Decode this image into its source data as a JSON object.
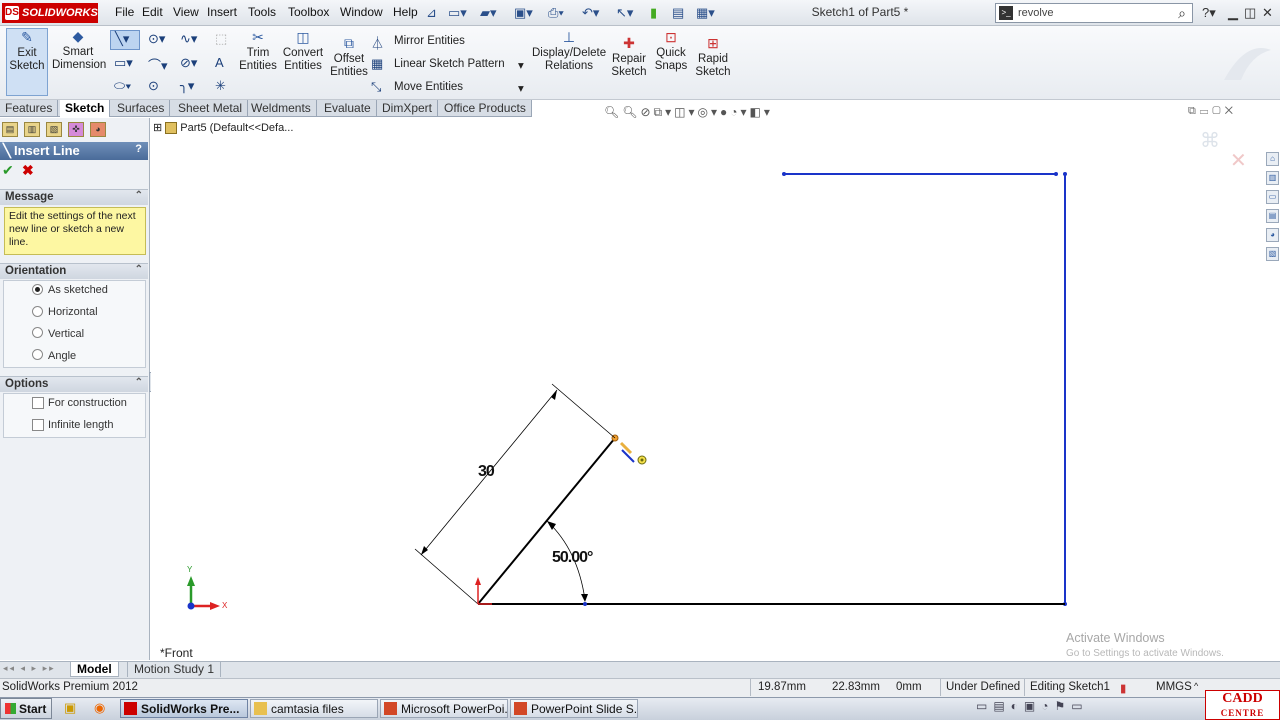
{
  "titlebar": {
    "app_logo": "SOLIDWORKS",
    "menus": [
      "File",
      "Edit",
      "View",
      "Insert",
      "Tools",
      "Toolbox",
      "Window",
      "Help"
    ],
    "document_title": "Sketch1 of Part5 *",
    "search_value": "revolve",
    "help_glyph": "?"
  },
  "commandmanager": {
    "exit_sketch": "Exit Sketch",
    "smart_dimension": "Smart Dimension",
    "trim_entities": "Trim Entities",
    "convert_entities": "Convert Entities",
    "offset_entities": "Offset Entities",
    "mirror_entities": "Mirror Entities",
    "linear_sketch_pattern": "Linear Sketch Pattern",
    "move_entities": "Move Entities",
    "display_delete_relations": "Display/Delete Relations",
    "repair_sketch": "Repair Sketch",
    "quick_snaps": "Quick Snaps",
    "rapid_sketch": "Rapid Sketch"
  },
  "tabs": [
    "Features",
    "Sketch",
    "Surfaces",
    "Sheet Metal",
    "Weldments",
    "Evaluate",
    "DimXpert",
    "Office Products"
  ],
  "active_tab": "Sketch",
  "property_manager": {
    "title": "Insert Line",
    "help": "?",
    "message_header": "Message",
    "message_text": "Edit the settings of the next new line or sketch a new line.",
    "orientation_header": "Orientation",
    "orientation_options": [
      "As sketched",
      "Horizontal",
      "Vertical",
      "Angle"
    ],
    "orientation_selected": "As sketched",
    "options_header": "Options",
    "options": [
      "For construction",
      "Infinite length"
    ]
  },
  "feature_tree": {
    "root": "Part5  (Default<<Defa..."
  },
  "graphics": {
    "dimension_length": "30",
    "dimension_angle": "50.00°",
    "view_label": "*Front",
    "triad_y": "Y",
    "triad_x": "X",
    "watermark_title": "Activate Windows",
    "watermark_sub": "Go to Settings to activate Windows."
  },
  "bottom_tabs": [
    "Model",
    "Motion Study 1"
  ],
  "status": {
    "product": "SolidWorks Premium 2012",
    "x": "19.87mm",
    "y": "22.83mm",
    "z": "0mm",
    "definition": "Under Defined",
    "mode": "Editing Sketch1",
    "units": "MMGS",
    "units_arrow": "^"
  },
  "taskbar": {
    "start": "Start",
    "tasks": [
      "SolidWorks Pre...",
      "camtasia files",
      "Microsoft PowerPoi...",
      "PowerPoint Slide S..."
    ],
    "brand": "CADD",
    "brand_sub": "CENTRE"
  },
  "colors": {
    "sketch_blue": "#1a34c9",
    "selected_line": "#000000",
    "message_bg": "#fdf7a2",
    "pm_title_bg": "#4a6b99"
  }
}
